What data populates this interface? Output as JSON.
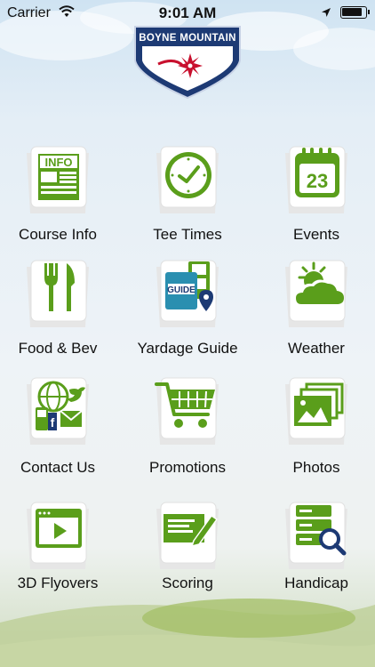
{
  "status_bar": {
    "carrier": "Carrier",
    "time": "9:01 AM"
  },
  "logo": {
    "text": "BOYNE MOUNTAIN"
  },
  "colors": {
    "accent_green": "#5a9e1b",
    "logo_navy": "#1d3a74",
    "logo_red": "#c8102e"
  },
  "menu": [
    {
      "label": "Course Info",
      "icon": "info-newspaper-icon"
    },
    {
      "label": "Tee Times",
      "icon": "clock-icon"
    },
    {
      "label": "Events",
      "icon": "calendar-icon",
      "calendar_day": "23"
    },
    {
      "label": "Food & Bev",
      "icon": "fork-knife-icon"
    },
    {
      "label": "Yardage Guide",
      "icon": "guide-map-icon",
      "badge": "GUIDE"
    },
    {
      "label": "Weather",
      "icon": "sun-cloud-icon"
    },
    {
      "label": "Contact Us",
      "icon": "contact-social-icon"
    },
    {
      "label": "Promotions",
      "icon": "shopping-cart-icon"
    },
    {
      "label": "Photos",
      "icon": "photos-icon"
    },
    {
      "label": "3D Flyovers",
      "icon": "video-player-icon"
    },
    {
      "label": "Scoring",
      "icon": "scorecard-pencil-icon"
    },
    {
      "label": "Handicap",
      "icon": "database-search-icon"
    }
  ]
}
